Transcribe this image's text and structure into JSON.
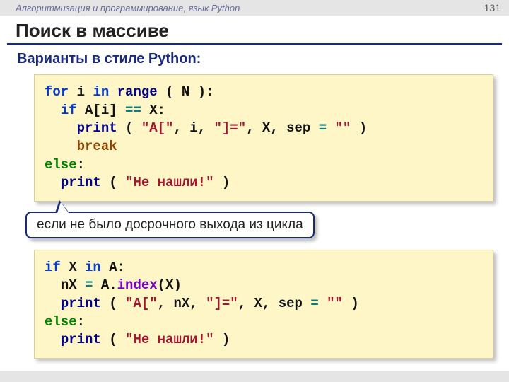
{
  "header": {
    "course": "Алгоритмизация и программирование, язык Python",
    "page": "131"
  },
  "title": "Поиск в массиве",
  "subtitle": "Варианты в стиле Python:",
  "code1": {
    "t1a": "for",
    "t1b": "i",
    "t1c": "in",
    "t1d": "range",
    "t1e": "( N ):",
    "t2a": "if",
    "t2b": "A[i]",
    "t2c": "==",
    "t2d": "X:",
    "t3a": "print",
    "t3b": "(",
    "t3c": "\"A[\"",
    "t3d": ", i,",
    "t3e": "\"]=\"",
    "t3f": ", X, sep",
    "t3g": "=",
    "t3h": "\"\"",
    "t3i": ")",
    "t4a": "break",
    "t5a": "else",
    "t5b": ":",
    "t6a": "print",
    "t6b": "(",
    "t6c": "\"Не нашли!\"",
    "t6d": ")"
  },
  "callout": "если не было досрочного выхода из цикла",
  "code2": {
    "t1a": "if",
    "t1b": "X",
    "t1c": "in",
    "t1d": "A:",
    "t2a": "nX",
    "t2b": "=",
    "t2c": "A.",
    "t2d": "index",
    "t2e": "(X)",
    "t3a": "print",
    "t3b": "(",
    "t3c": "\"A[\"",
    "t3d": ", nX,",
    "t3e": "\"]=\"",
    "t3f": ", X, sep",
    "t3g": "=",
    "t3h": "\"\"",
    "t3i": ")",
    "t4a": "else",
    "t4b": ":",
    "t5a": "print",
    "t5b": "(",
    "t5c": "\"Не нашли!\"",
    "t5d": ")"
  }
}
